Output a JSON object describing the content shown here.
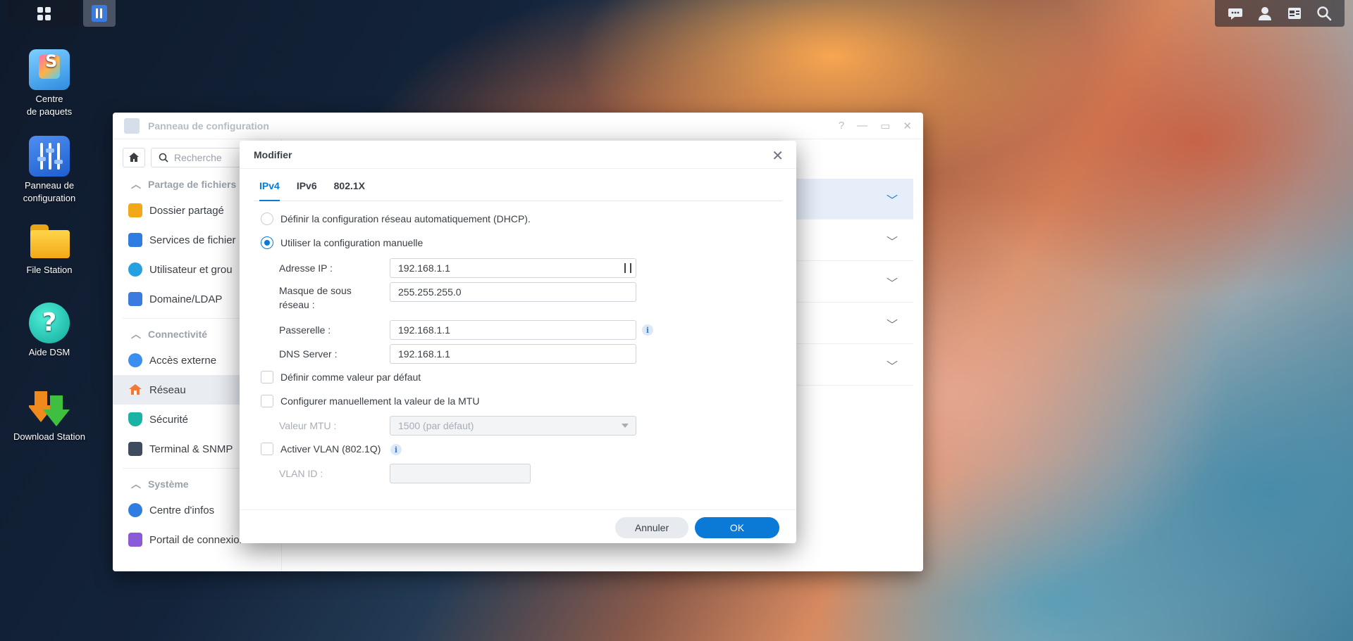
{
  "desktop": {
    "icons": [
      {
        "label": "Centre\nde paquets"
      },
      {
        "label": "Panneau de\nconfiguration"
      },
      {
        "label": "File Station"
      },
      {
        "label": "Aide DSM"
      },
      {
        "label": "Download Station"
      }
    ]
  },
  "window": {
    "title": "Panneau de configuration",
    "controls": {
      "help": "?",
      "minimize": "—",
      "maximize": "▭",
      "close": "✕"
    }
  },
  "sidebar": {
    "search_placeholder": "Recherche",
    "sections": [
      {
        "title": "Partage de fichiers",
        "items": [
          "Dossier partagé",
          "Services de fichier",
          "Utilisateur et grou",
          "Domaine/LDAP"
        ]
      },
      {
        "title": "Connectivité",
        "items": [
          "Accès externe",
          "Réseau",
          "Sécurité",
          "Terminal & SNMP"
        ]
      },
      {
        "title": "Système",
        "items": [
          "Centre d'infos",
          "Portail de connexion"
        ]
      }
    ],
    "active_item": "Réseau"
  },
  "dialog": {
    "title": "Modifier",
    "tabs": [
      "IPv4",
      "IPv6",
      "802.1X"
    ],
    "active_tab": "IPv4",
    "options": {
      "dhcp": "Définir la configuration réseau automatiquement (DHCP).",
      "manual": "Utiliser la configuration manuelle"
    },
    "selected_option": "manual",
    "fields": {
      "ip_label": "Adresse IP :",
      "ip_value": "192.168.1.1",
      "mask_label": "Masque de sous\nréseau :",
      "mask_value": "255.255.255.0",
      "gateway_label": "Passerelle :",
      "gateway_value": "192.168.1.1",
      "dns_label": "DNS Server :",
      "dns_value": "192.168.1.1"
    },
    "checkboxes": {
      "default": "Définir comme valeur par défaut",
      "mtu": "Configurer manuellement la valeur de la MTU",
      "vlan": "Activer VLAN (802.1Q)"
    },
    "mtu": {
      "label": "Valeur MTU :",
      "value": "1500 (par défaut)"
    },
    "vlan": {
      "label": "VLAN ID :",
      "value": ""
    },
    "buttons": {
      "cancel": "Annuler",
      "ok": "OK"
    },
    "colors": {
      "accent": "#0a7ad6"
    }
  }
}
